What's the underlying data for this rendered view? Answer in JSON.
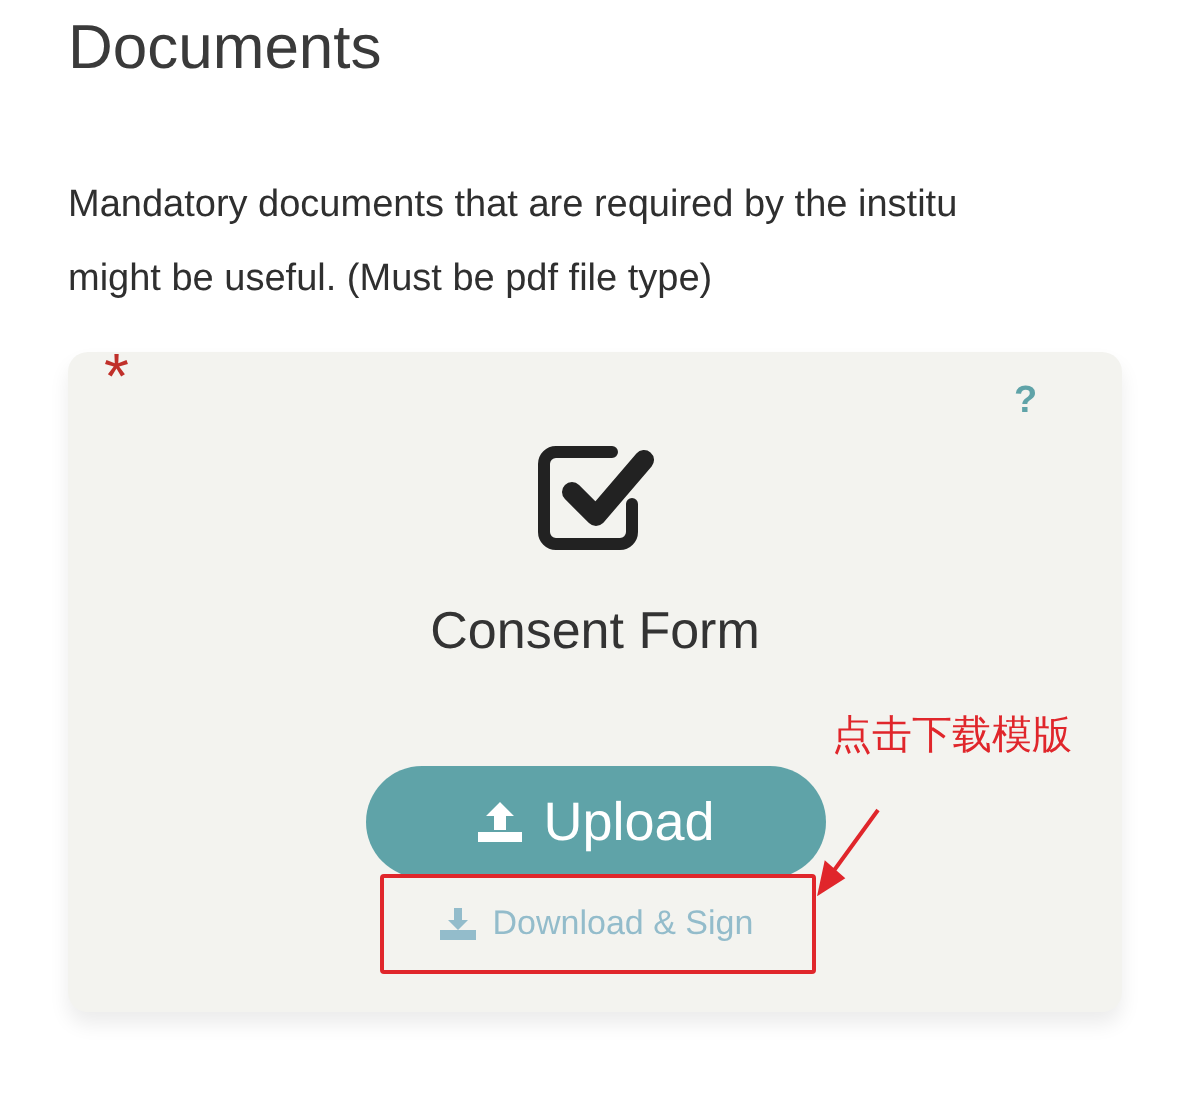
{
  "heading": "Documents",
  "description_lines": [
    "Mandatory documents that are required by the institu",
    "might be useful. (Must be pdf file type)"
  ],
  "document": {
    "title": "Consent Form",
    "required_mark": "*",
    "help": "?",
    "upload_button": "Upload",
    "download_link": "Download & Sign"
  },
  "annotation": {
    "label": "点击下载模版"
  }
}
